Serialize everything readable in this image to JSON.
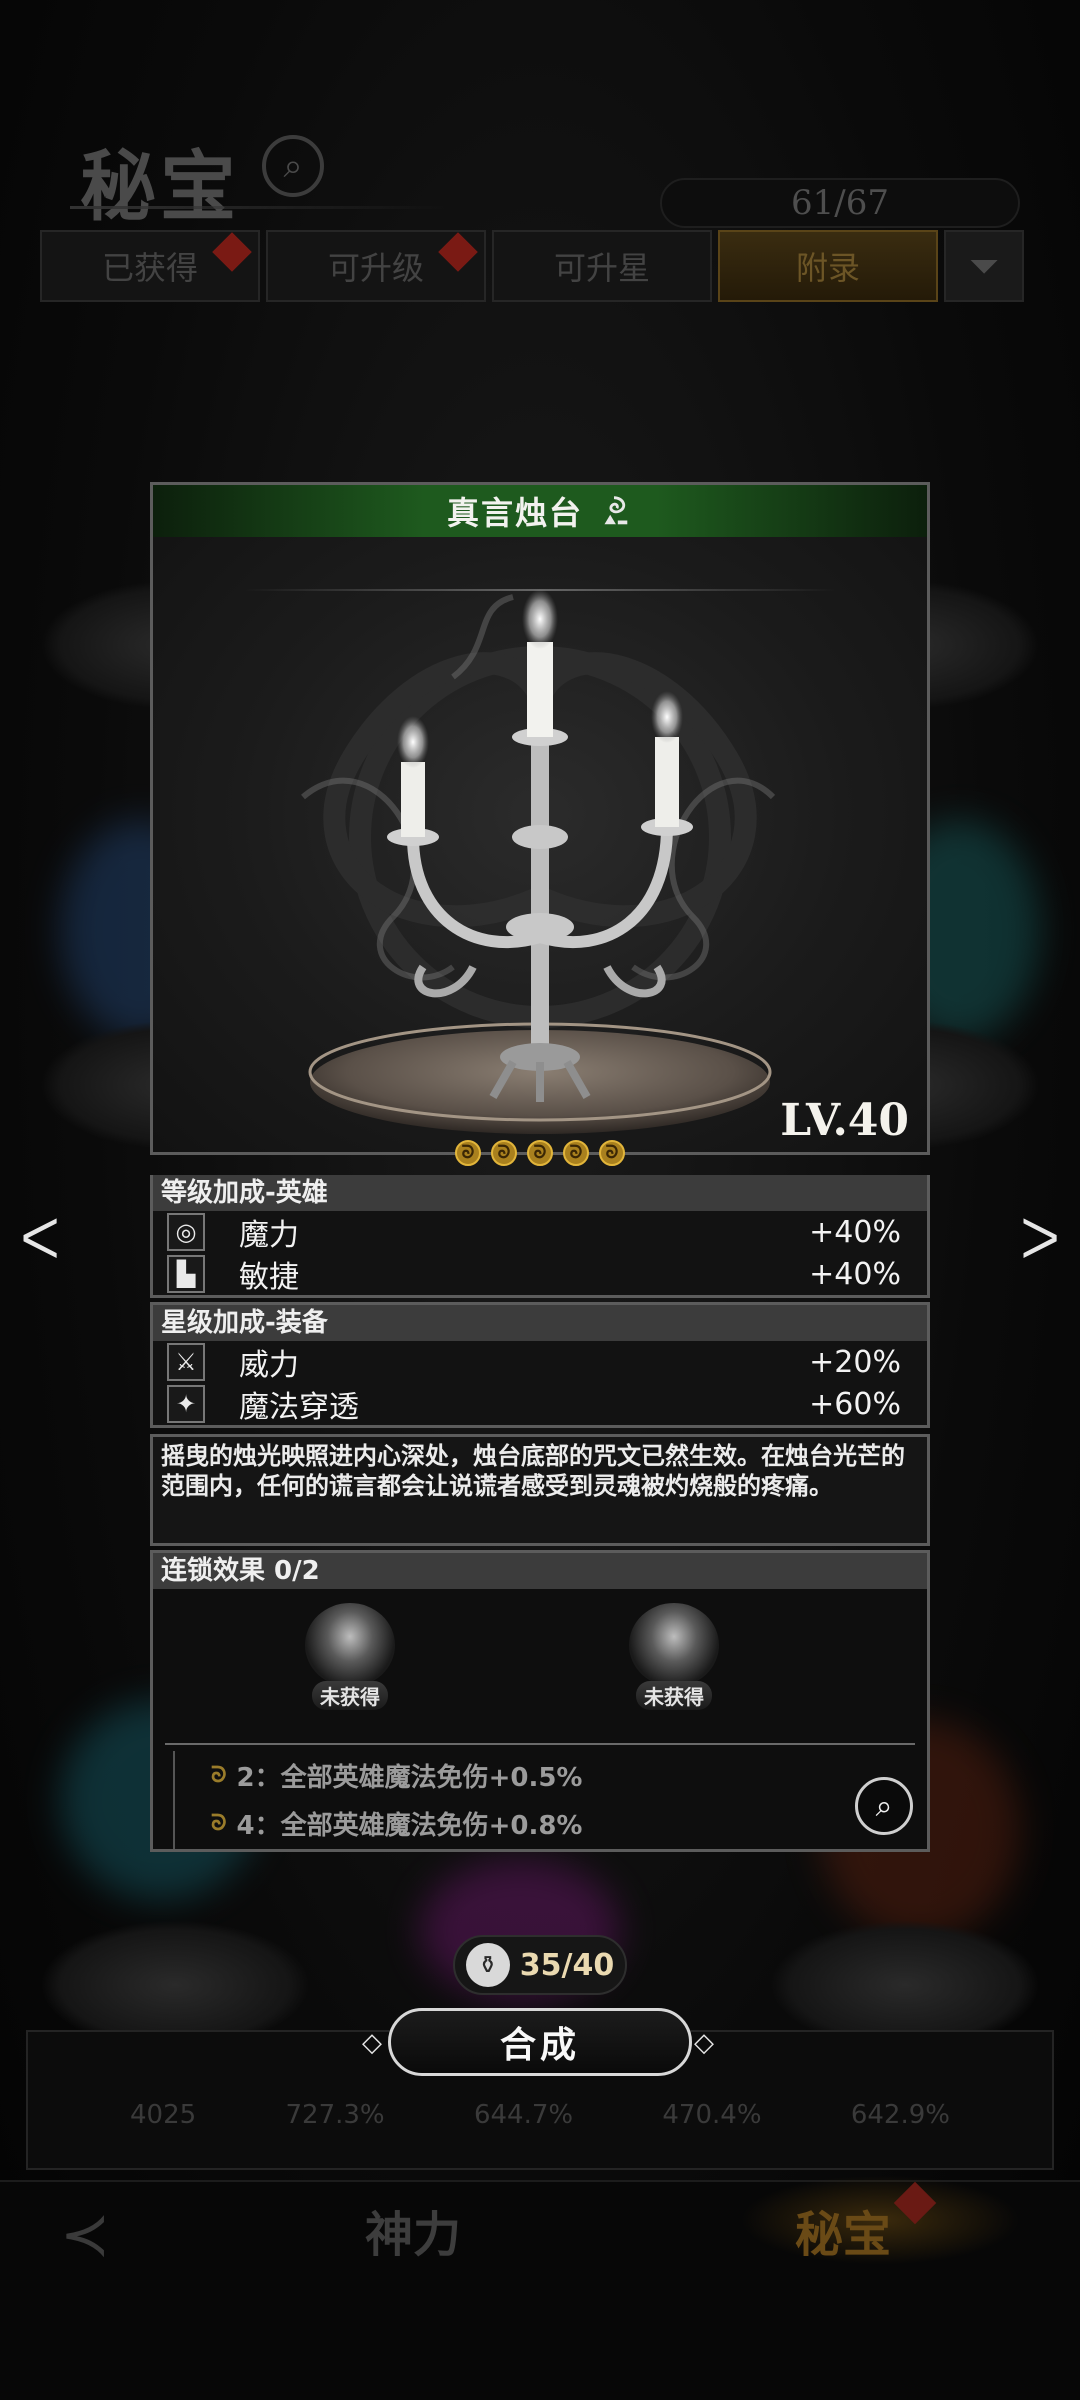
{
  "background": {
    "title": "秘宝",
    "count": "61/67",
    "tabs": [
      "已获得",
      "可升级",
      "可升星",
      "附录"
    ],
    "stats": [
      "4025",
      "727.3%",
      "644.7%",
      "470.4%",
      "642.9%"
    ],
    "nav": {
      "left": "神力",
      "right": "秘宝"
    }
  },
  "popup": {
    "title": "真言烛台",
    "level": "LV.40",
    "stars": 5,
    "hero_bonus": {
      "header": "等级加成-英雄",
      "rows": [
        {
          "name": "魔力",
          "value": "+40%",
          "icon": "swirl-icon"
        },
        {
          "name": "敏捷",
          "value": "+40%",
          "icon": "boot-icon"
        }
      ]
    },
    "equip_bonus": {
      "header": "星级加成-装备",
      "rows": [
        {
          "name": "威力",
          "value": "+20%",
          "icon": "crossed-swords-icon"
        },
        {
          "name": "魔法穿透",
          "value": "+60%",
          "icon": "magic-pierce-icon"
        }
      ]
    },
    "description": "摇曳的烛光映照进内心深处，烛台底部的咒文已然生效。在烛台光芒的范围内，任何的谎言都会让说谎者感受到灵魂被灼烧般的疼痛。",
    "chain": {
      "header": "连锁效果 0/2",
      "items": [
        {
          "label": "未获得"
        },
        {
          "label": "未获得"
        }
      ],
      "bonuses": [
        "2：全部英雄魔法免伤+0.5%",
        "4：全部英雄魔法免伤+0.8%"
      ]
    }
  },
  "cost": "35/40",
  "combine_label": "合成",
  "colors": {
    "accent_green": "#1e5a1e",
    "gold": "#a9801e",
    "frame": "#5c5c5c"
  }
}
